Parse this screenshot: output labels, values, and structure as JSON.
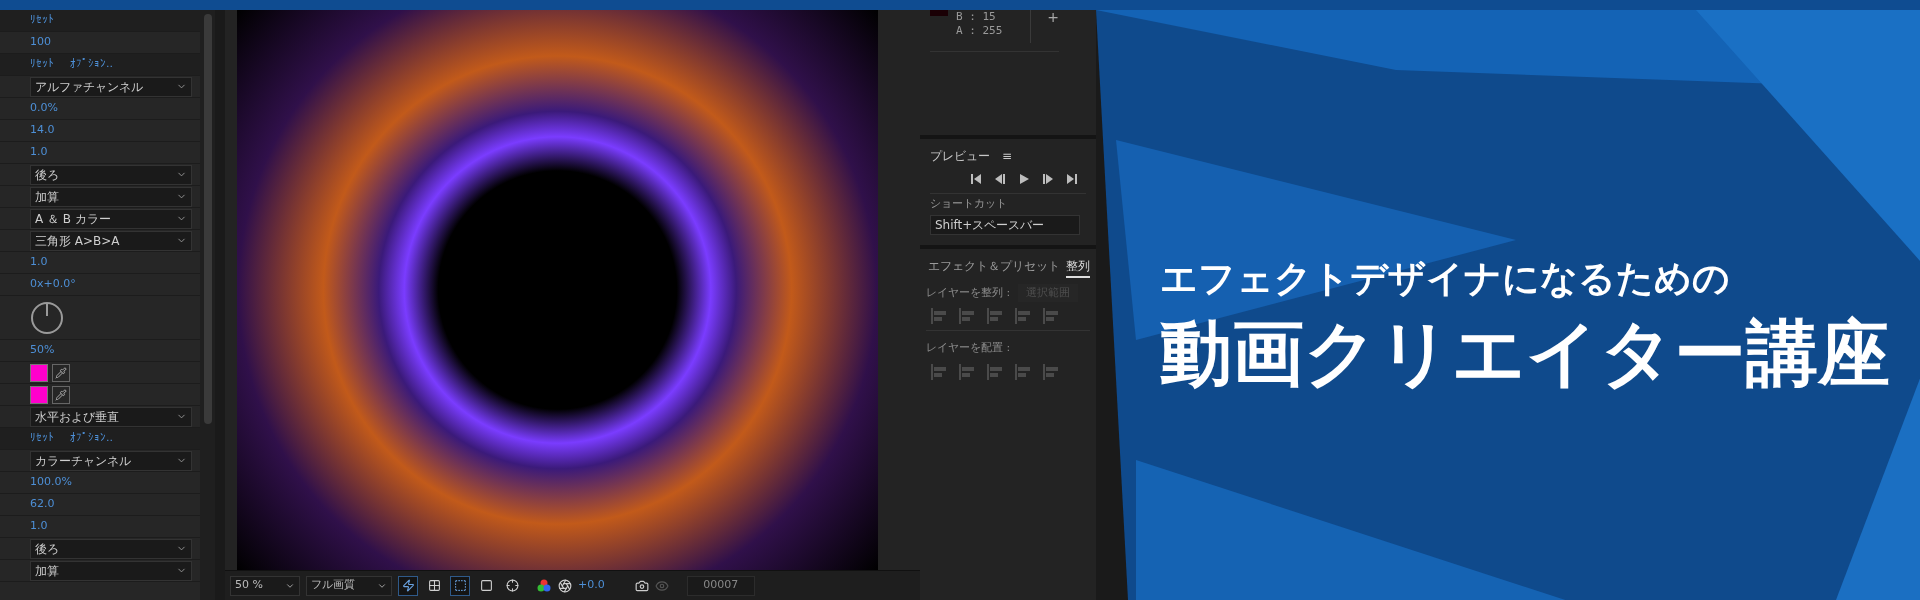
{
  "effect_controls": {
    "rows": [
      {
        "kind": "links",
        "links": [
          "ﾘｾｯﾄ"
        ]
      },
      {
        "kind": "value",
        "text": "100"
      },
      {
        "kind": "links",
        "links": [
          "ﾘｾｯﾄ",
          "ｵﾌﾟｼｮﾝ.."
        ]
      },
      {
        "kind": "dropdown",
        "text": "アルファチャンネル"
      },
      {
        "kind": "value",
        "text": "0.0%"
      },
      {
        "kind": "value",
        "text": "14.0"
      },
      {
        "kind": "value",
        "text": "1.0"
      },
      {
        "kind": "dropdown",
        "text": "後ろ"
      },
      {
        "kind": "dropdown",
        "text": "加算"
      },
      {
        "kind": "dropdown",
        "text": "A ＆ B カラー"
      },
      {
        "kind": "dropdown",
        "text": "三角形 A>B>A"
      },
      {
        "kind": "value",
        "text": "1.0"
      },
      {
        "kind": "value",
        "text": "0x+0.0°"
      },
      {
        "kind": "dial"
      },
      {
        "kind": "value",
        "text": "50%"
      },
      {
        "kind": "swatch",
        "color": "#ff00cc"
      },
      {
        "kind": "swatch",
        "color": "#ff00cc"
      },
      {
        "kind": "dropdown",
        "text": "水平および垂直"
      },
      {
        "kind": "links",
        "links": [
          "ﾘｾｯﾄ",
          "ｵﾌﾟｼｮﾝ.."
        ]
      },
      {
        "kind": "dropdown",
        "text": "カラーチャンネル"
      },
      {
        "kind": "value",
        "text": "100.0%"
      },
      {
        "kind": "value",
        "text": "62.0"
      },
      {
        "kind": "value",
        "text": "1.0"
      },
      {
        "kind": "dropdown",
        "text": "後ろ"
      },
      {
        "kind": "dropdown",
        "text": "加算"
      }
    ]
  },
  "viewer_toolbar": {
    "zoom": "50 %",
    "resolution": "フル画質",
    "view_toggles": [
      {
        "on": true
      },
      {
        "on": false
      },
      {
        "on": true
      },
      {
        "on": false
      },
      {
        "on": false
      }
    ],
    "exposure": "+0.0",
    "frame": "00007"
  },
  "info_panel": {
    "lines": [
      "B : 15",
      "A : 255"
    ],
    "add": "+"
  },
  "preview_panel": {
    "title": "プレビュー",
    "menu": "≡",
    "shortcut_label": "ショートカット",
    "shortcut": "Shift+スペースバー"
  },
  "align_panel": {
    "tabs": [
      {
        "label": "エフェクト＆プリセット",
        "selected": false
      },
      {
        "label": "整列",
        "selected": true
      }
    ],
    "align_label": "レイヤーを整列 :",
    "align_target": {
      "text": "選択範囲",
      "disabled": true
    },
    "distribute_label": "レイヤーを配置 :"
  },
  "banner": {
    "subtitle": "エフェクトデザイナになるための",
    "title": "動画クリエイター講座"
  }
}
